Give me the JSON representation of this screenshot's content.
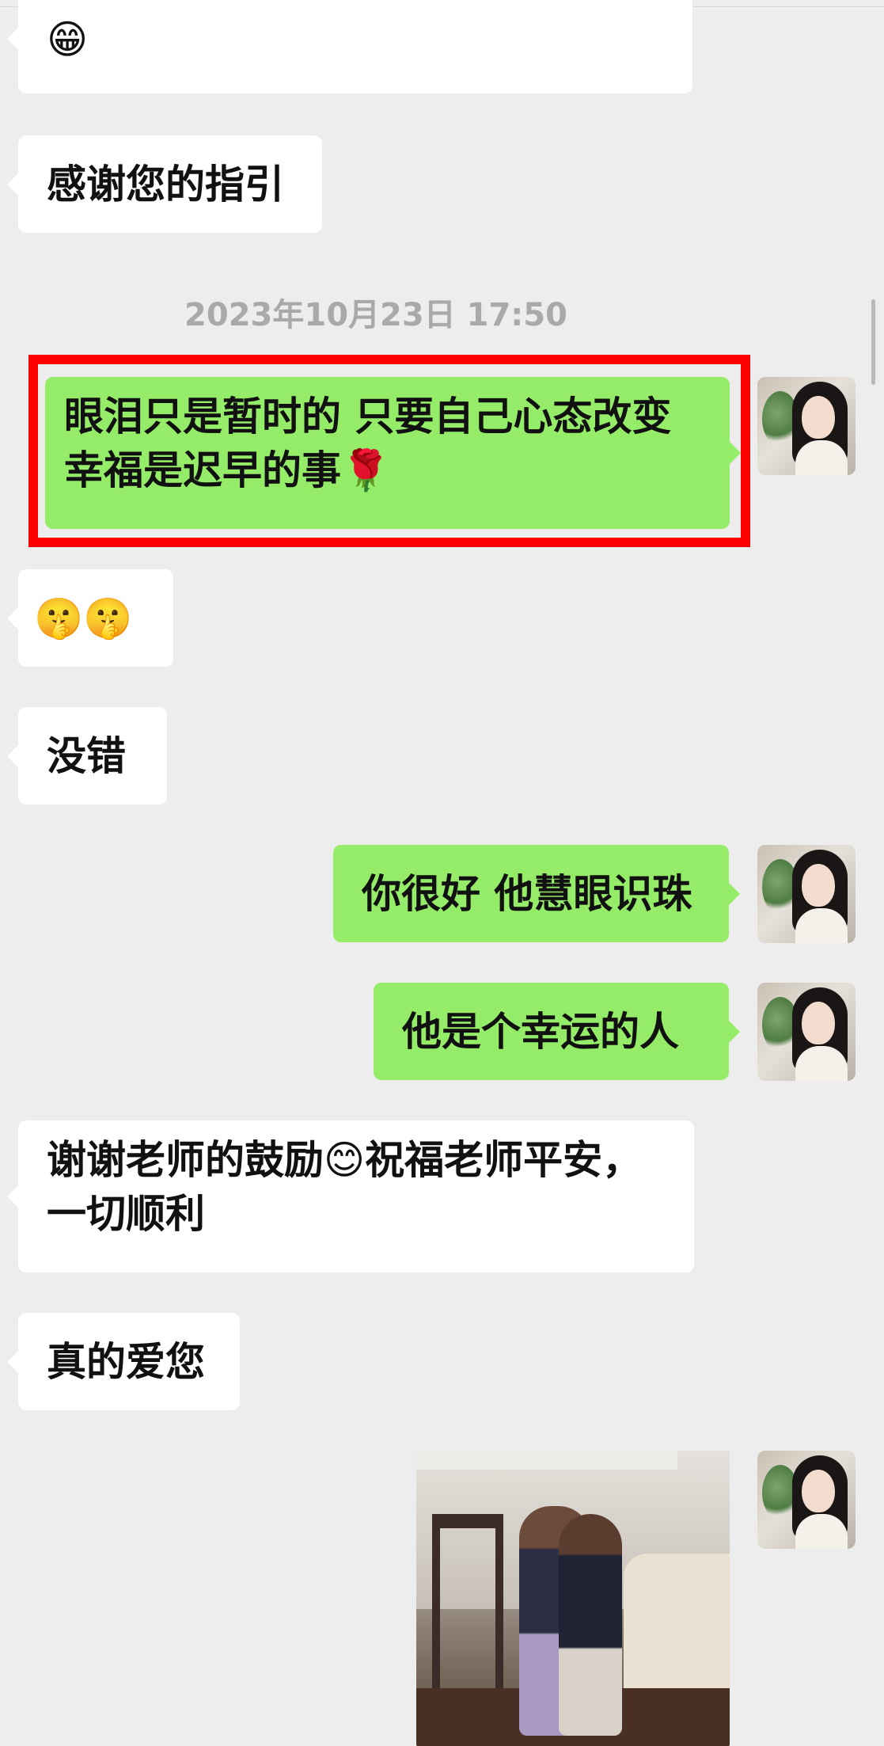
{
  "messages": {
    "m0": {
      "emoji": "😁"
    },
    "m1": {
      "text": "感谢您的指引"
    },
    "timestamp": "2023年10月23日 17:50",
    "m2": {
      "line1": "眼泪只是暂时的 只要自己心态改变",
      "line2": "幸福是迟早的事",
      "emoji": "🌹"
    },
    "m3": {
      "emoji": "🤫🤫"
    },
    "m4": {
      "text": "没错"
    },
    "m5": {
      "text": "你很好 他慧眼识珠"
    },
    "m6": {
      "text": "他是个幸运的人"
    },
    "m7": {
      "part1": "谢谢老师的鼓励",
      "emoji": "😊",
      "part2": "祝福老师平安，",
      "line2": "一切顺利"
    },
    "m8": {
      "text": "真的爱您"
    }
  },
  "colors": {
    "background": "#ededed",
    "incoming_bubble": "#ffffff",
    "outgoing_bubble": "#95ec69",
    "highlight_border": "#ff0000",
    "timestamp_text": "#a9a9a9"
  },
  "icons": {
    "avatar": "user-avatar-photo",
    "image_message": "photo-of-two-children-hugging"
  }
}
